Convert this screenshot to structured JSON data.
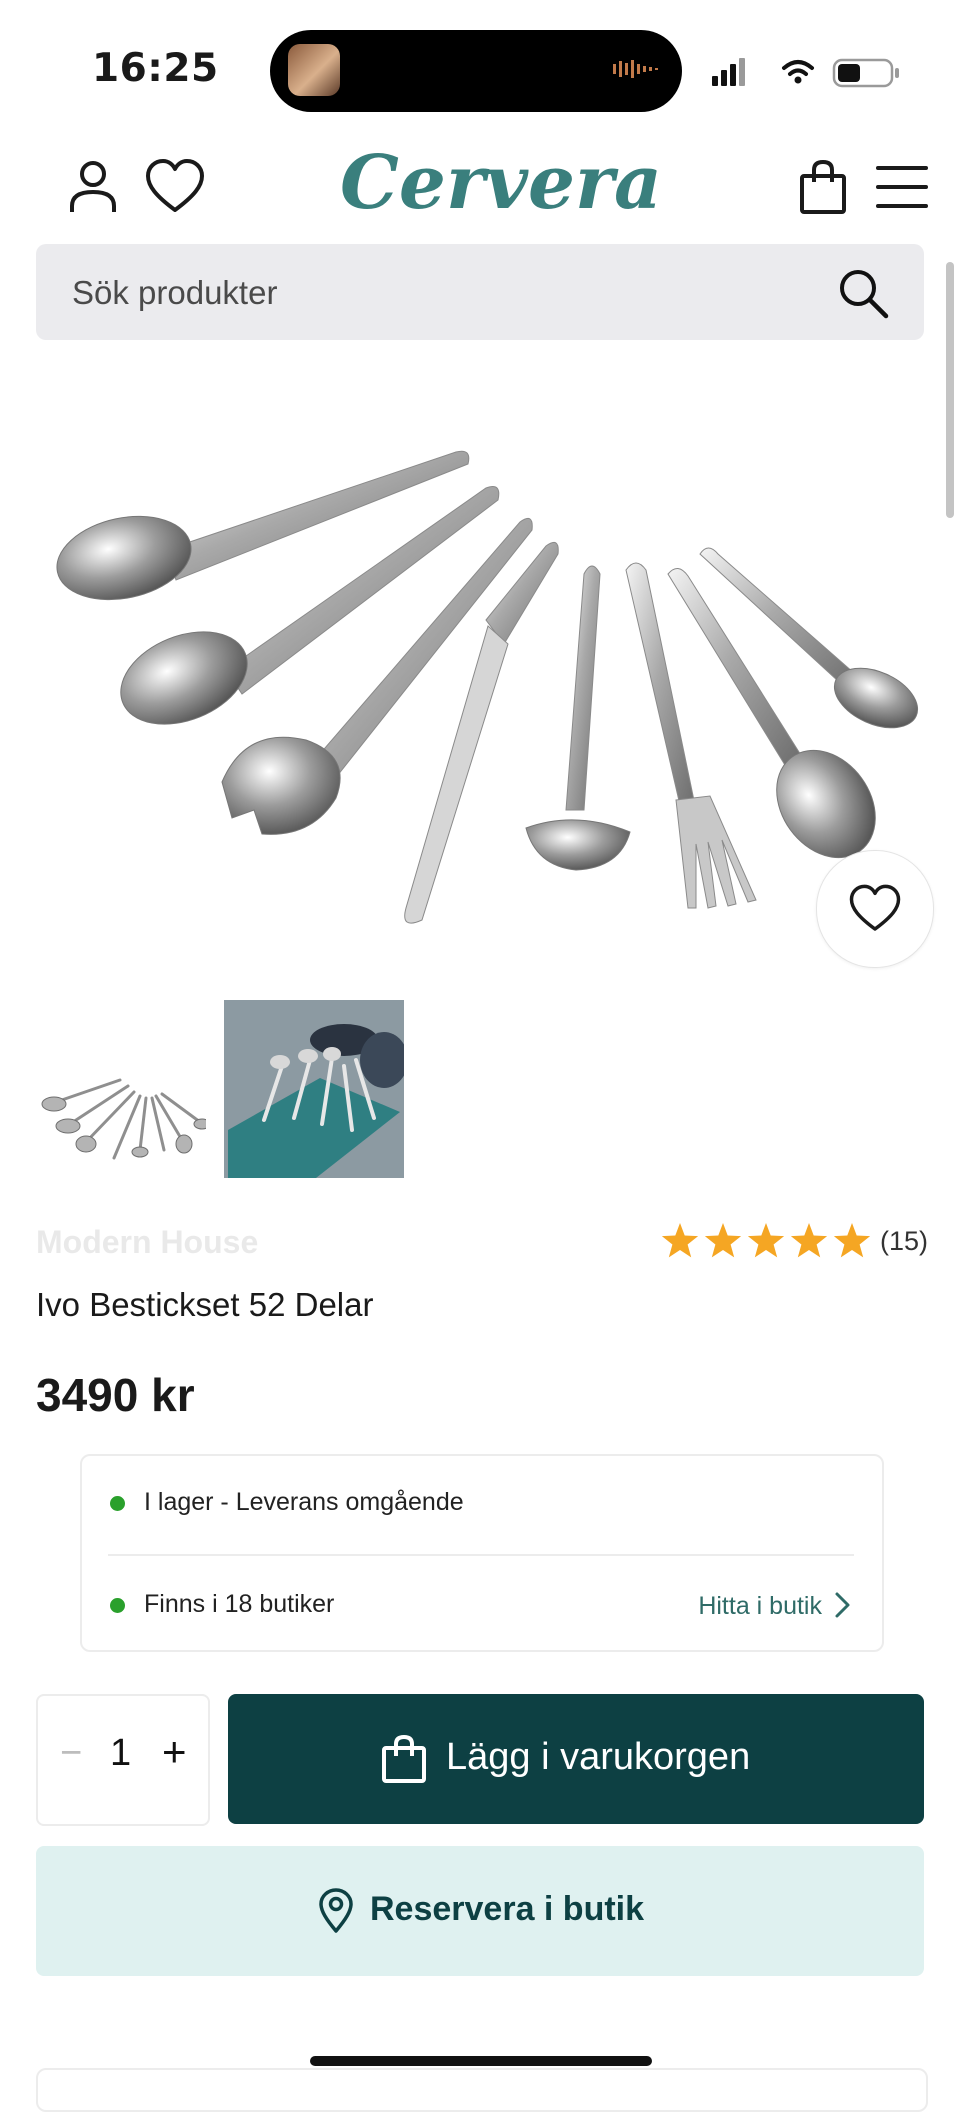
{
  "status_bar": {
    "time": "16:25"
  },
  "header": {
    "logo": "Cervera"
  },
  "search": {
    "placeholder": "Sök produkter"
  },
  "product": {
    "brand": "Modern House",
    "rating_count": "(15)",
    "rating_value": 5,
    "rating_max": 5,
    "title": "Ivo Bestickset 52 Delar",
    "price": "3490 kr"
  },
  "stock": {
    "in_stock": "I lager - Leverans omgående",
    "stores": "Finns i 18 butiker",
    "find_link": "Hitta i butik"
  },
  "quantity": {
    "minus": "−",
    "value": "1",
    "plus": "+"
  },
  "actions": {
    "add_to_cart": "Lägg i varukorgen",
    "reserve": "Reservera i butik"
  },
  "colors": {
    "brand_teal": "#3a7f7d",
    "cart_button": "#0d4043",
    "reserve_button": "#dff1f0",
    "star": "#f5a623",
    "stock_dot": "#2aa02c"
  },
  "icons": {
    "account": "user-icon",
    "wishlist": "heart-icon",
    "cart": "shopping-bag-icon",
    "menu": "hamburger-menu-icon",
    "search": "search-icon",
    "find": "chevron-right-icon",
    "reserve": "location-pin-icon"
  }
}
